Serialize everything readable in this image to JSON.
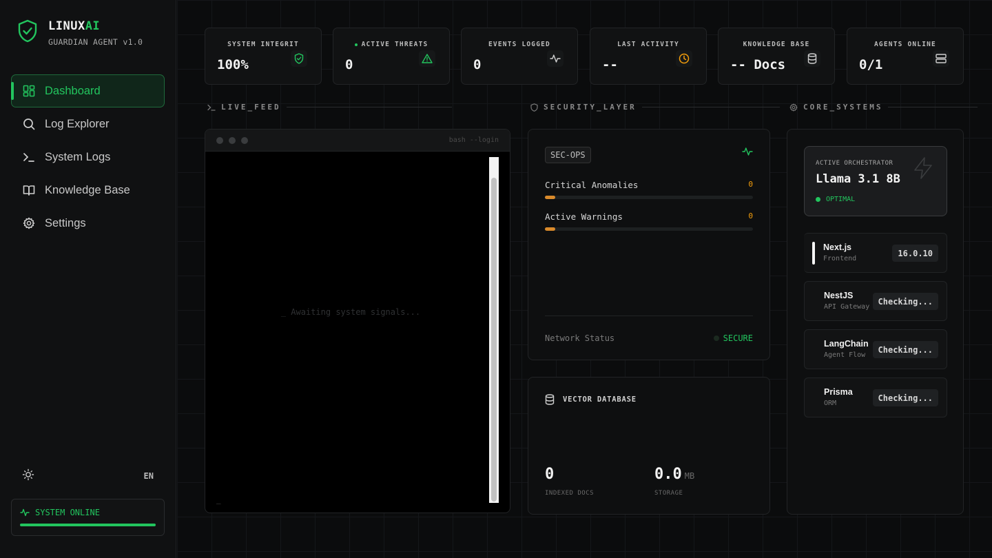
{
  "brand": {
    "title_main": "LINUX",
    "title_accent": "AI",
    "subtitle": "GUARDIAN AGENT v1.0",
    "accent_color": "#22c55e"
  },
  "sidebar": {
    "items": [
      {
        "label": "Dashboard",
        "icon": "grid-icon",
        "active": true
      },
      {
        "label": "Log Explorer",
        "icon": "search-icon"
      },
      {
        "label": "System Logs",
        "icon": "terminal-icon"
      },
      {
        "label": "Knowledge Base",
        "icon": "book-icon"
      },
      {
        "label": "Settings",
        "icon": "gear-icon"
      }
    ],
    "language": "EN",
    "status": "SYSTEM ONLINE"
  },
  "stats": [
    {
      "label": "SYSTEM INTEGRIT",
      "value": "100%",
      "icon": "shield-check-icon",
      "icon_color": "#22c55e"
    },
    {
      "label": "ACTIVE THREATS",
      "value": "0",
      "icon": "warning-icon",
      "icon_color": "#22c55e"
    },
    {
      "label": "EVENTS LOGGED",
      "value": "0",
      "icon": "activity-icon",
      "icon_color": "#d0d0d0"
    },
    {
      "label": "LAST ACTIVITY",
      "value": "--",
      "icon": "clock-icon",
      "icon_color": "#f59e0b"
    },
    {
      "label": "KNOWLEDGE BASE",
      "value": "-- Docs",
      "icon": "database-icon",
      "icon_color": "#d0d0d0"
    },
    {
      "label": "AGENTS ONLINE",
      "value": "0/1",
      "icon": "server-icon",
      "icon_color": "#d0d0d0"
    }
  ],
  "sections": {
    "live_feed": "LIVE_FEED",
    "security": "SECURITY_LAYER",
    "core": "CORE_SYSTEMS"
  },
  "terminal": {
    "title": "bash --login",
    "message": "_ Awaiting system signals...",
    "cursor": "_"
  },
  "security": {
    "badge": "SEC-OPS",
    "rows": [
      {
        "label": "Critical Anomalies",
        "value": "0"
      },
      {
        "label": "Active Warnings",
        "value": "0"
      }
    ],
    "network_label": "Network Status",
    "network_status": "SECURE"
  },
  "vector_db": {
    "title": "VECTOR DATABASE",
    "docs_value": "0",
    "docs_label": "INDEXED DOCS",
    "storage_value": "0.0",
    "storage_unit": "MB",
    "storage_label": "STORAGE"
  },
  "core": {
    "orchestrator_label": "ACTIVE ORCHESTRATOR",
    "orchestrator_name": "Llama 3.1 8B",
    "orchestrator_status": "OPTIMAL",
    "services": [
      {
        "name": "Next.js",
        "sub": "Frontend",
        "version": "16.0.10"
      },
      {
        "name": "NestJS",
        "sub": "API Gateway",
        "version": "Checking..."
      },
      {
        "name": "LangChain",
        "sub": "Agent Flow",
        "version": "Checking..."
      },
      {
        "name": "Prisma",
        "sub": "ORM",
        "version": "Checking..."
      }
    ]
  }
}
